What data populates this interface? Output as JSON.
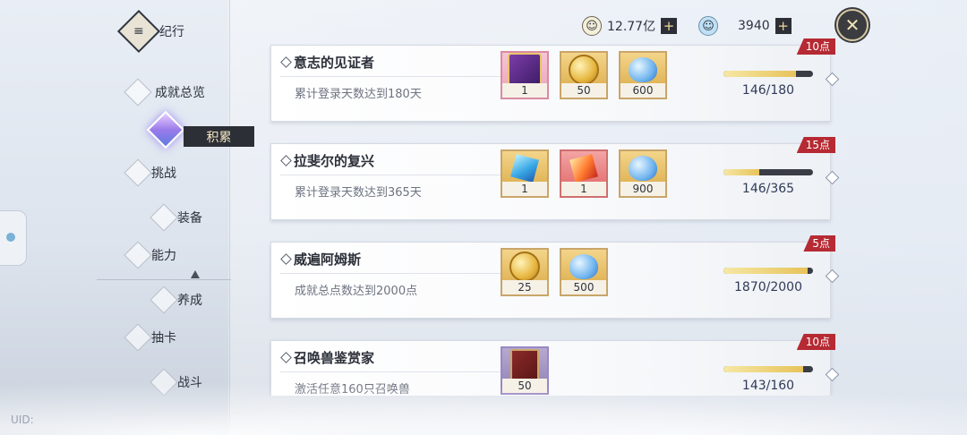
{
  "nav": {
    "title": "纪行",
    "active_tag": "积累",
    "items": [
      {
        "label": "成就总览"
      },
      {
        "label": "挑战"
      },
      {
        "label": "装备"
      },
      {
        "label": "能力"
      },
      {
        "label": "养成"
      },
      {
        "label": "抽卡"
      },
      {
        "label": "战斗"
      }
    ],
    "uid": "UID:"
  },
  "topbar": {
    "gold_amount": "12.77亿",
    "gem_amount": "3940",
    "plus": "+",
    "close": "✕"
  },
  "achievements": [
    {
      "title": "意志的见证者",
      "desc": "累计登录天数达到180天",
      "points": "10点",
      "progress_text": "146/180",
      "progress": 0.81,
      "rewards": [
        {
          "type": "hero",
          "qty": "1"
        },
        {
          "type": "coin",
          "qty": "50"
        },
        {
          "type": "slime",
          "qty": "600"
        }
      ]
    },
    {
      "title": "拉斐尔的复兴",
      "desc": "累计登录天数达到365天",
      "points": "15点",
      "progress_text": "146/365",
      "progress": 0.4,
      "rewards": [
        {
          "type": "cube-blue",
          "qty": "1"
        },
        {
          "type": "cube-red",
          "qty": "1"
        },
        {
          "type": "slime",
          "qty": "900"
        }
      ]
    },
    {
      "title": "威遍阿姆斯",
      "desc": "成就总点数达到2000点",
      "points": "5点",
      "progress_text": "1870/2000",
      "progress": 0.935,
      "rewards": [
        {
          "type": "coin",
          "qty": "25"
        },
        {
          "type": "slime",
          "qty": "500"
        }
      ]
    },
    {
      "title": "召唤兽鉴赏家",
      "desc": "激活任意160只召唤兽",
      "points": "10点",
      "progress_text": "143/160",
      "progress": 0.89,
      "rewards": [
        {
          "type": "tome",
          "qty": "50"
        }
      ]
    }
  ]
}
